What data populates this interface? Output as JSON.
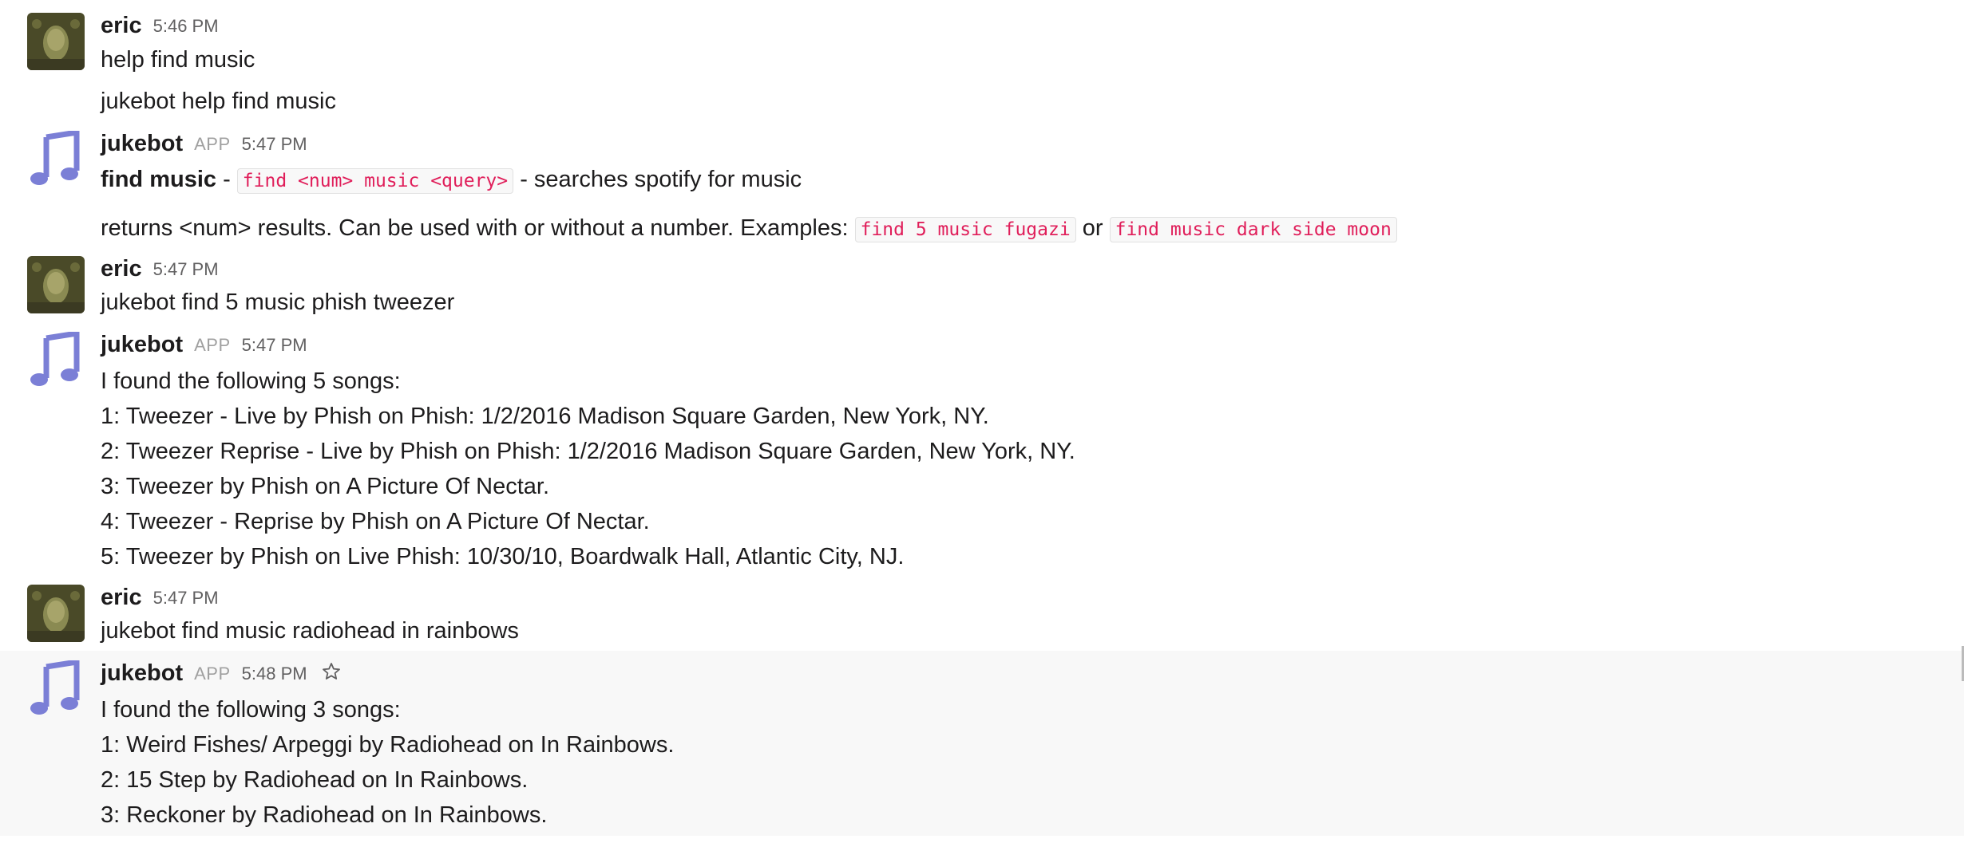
{
  "messages": [
    {
      "author": "eric",
      "time": "5:46 PM",
      "lines": [
        "help find music",
        "jukebot help find music"
      ]
    },
    {
      "author": "jukebot",
      "badge": "APP",
      "time": "5:47 PM",
      "l1_bold": "find music",
      "l1_dash": " - ",
      "l1_code": "find <num> music <query>",
      "l1_rest": " - searches spotify for music",
      "l2_text": "returns <num> results. Can be used with or without a number. Examples: ",
      "l2_code1": "find 5 music fugazi",
      "l2_or": " or ",
      "l2_code2": "find music dark side moon"
    },
    {
      "author": "eric",
      "time": "5:47 PM",
      "lines": [
        "jukebot find 5 music phish tweezer"
      ]
    },
    {
      "author": "jukebot",
      "badge": "APP",
      "time": "5:47 PM",
      "lines": [
        "I found the following 5 songs:",
        "1: Tweezer - Live by Phish on Phish: 1/2/2016 Madison Square Garden, New York, NY.",
        "2: Tweezer Reprise - Live by Phish on Phish: 1/2/2016 Madison Square Garden, New York, NY.",
        "3: Tweezer by Phish on A Picture Of Nectar.",
        "4: Tweezer - Reprise by Phish on A Picture Of Nectar.",
        "5: Tweezer by Phish on Live Phish: 10/30/10, Boardwalk Hall, Atlantic City, NJ."
      ]
    },
    {
      "author": "eric",
      "time": "5:47 PM",
      "lines": [
        "jukebot find music radiohead in rainbows"
      ]
    },
    {
      "author": "jukebot",
      "badge": "APP",
      "time": "5:48 PM",
      "lines": [
        "I found the following 3 songs:",
        "1: Weird Fishes/ Arpeggi by Radiohead on In Rainbows.",
        "2: 15 Step by Radiohead on In Rainbows.",
        "3: Reckoner by Radiohead on In Rainbows."
      ]
    }
  ],
  "icons": {
    "star": "star-outline-icon",
    "jukebot_avatar": "music-note-icon",
    "eric_avatar": "user-portrait"
  },
  "colors": {
    "code_text": "#e01e5a",
    "note": "#7b7fd6",
    "hover_bg": "#f8f8f8"
  }
}
